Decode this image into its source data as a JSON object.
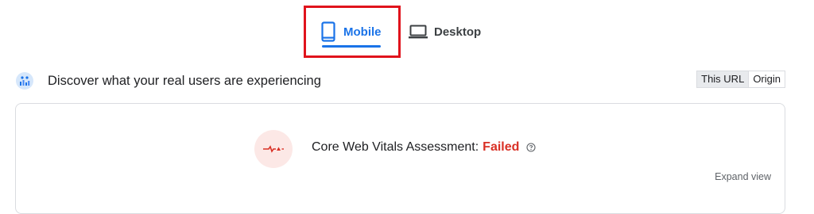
{
  "tabs": {
    "mobile_label": "Mobile",
    "desktop_label": "Desktop",
    "active": "Mobile"
  },
  "field_data": {
    "heading": "Discover what your real users are experiencing",
    "toggle": {
      "this_url": "This URL",
      "origin": "Origin",
      "selected": "This URL"
    }
  },
  "assessment": {
    "label": "Core Web Vitals Assessment:",
    "status": "Failed",
    "expand_label": "Expand view"
  },
  "colors": {
    "accent": "#1a73e8",
    "failed": "#d93025",
    "highlight_box": "#e0131c"
  },
  "icons": {
    "mobile_tab": "smartphone-icon",
    "desktop_tab": "laptop-icon",
    "discover": "users-chart-icon",
    "assessment": "pulse-failed-icon",
    "help": "help-circle-icon"
  }
}
